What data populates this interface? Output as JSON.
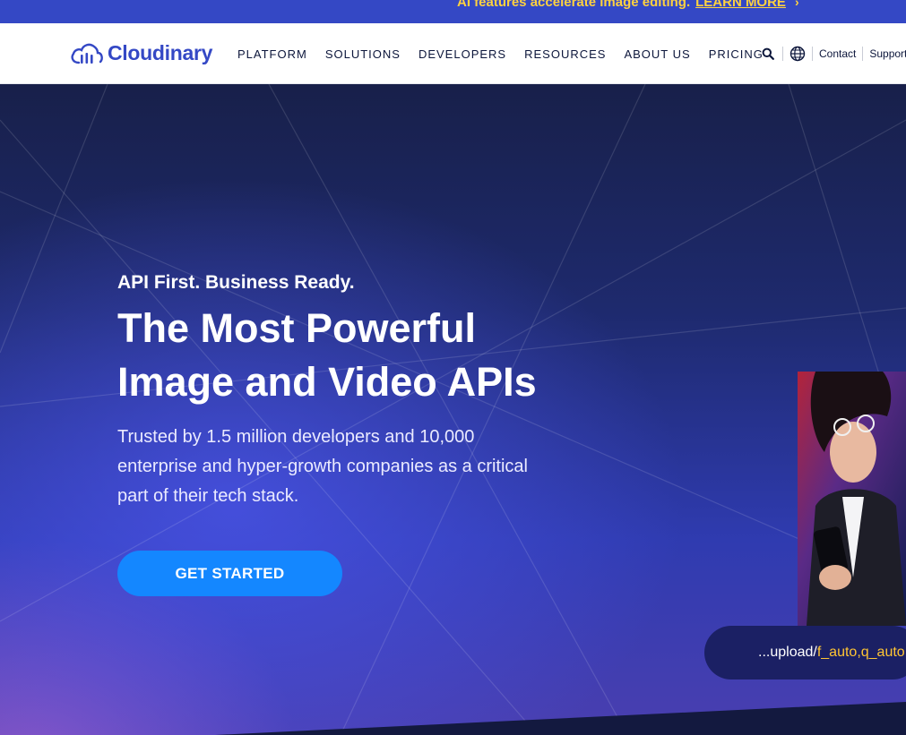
{
  "announcement": {
    "text": "AI features accelerate image editing.",
    "link": "LEARN MORE"
  },
  "header": {
    "logo_text": "Cloudinary",
    "nav": [
      "PLATFORM",
      "SOLUTIONS",
      "DEVELOPERS",
      "RESOURCES",
      "ABOUT US",
      "PRICING"
    ],
    "contact": "Contact",
    "support": "Support"
  },
  "hero": {
    "eyebrow": "API First. Business Ready.",
    "headline_line1": "The Most Powerful",
    "headline_line2": "Image and Video APIs",
    "subtext": "Trusted by 1.5 million developers and 10,000 enterprise and hyper-growth companies as a critical part of their tech stack.",
    "cta": "GET STARTED",
    "url_prefix": "...upload/",
    "url_params": "f_auto,q_auto"
  },
  "colors": {
    "brand": "#3448c5",
    "accent_yellow": "#ffd23f",
    "cta_blue": "#1487ff"
  }
}
